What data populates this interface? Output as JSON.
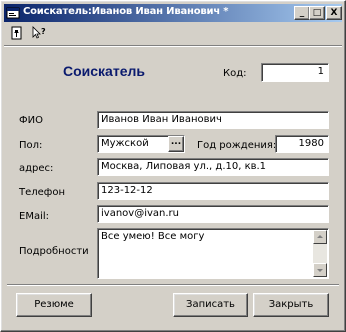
{
  "window": {
    "title": "Соискатель:Иванов Иван Иванович *",
    "controls": {
      "minimize": "_",
      "maximize": "□",
      "close": "X"
    }
  },
  "toolbar": {
    "icons": [
      "document-pin-icon",
      "help-pointer-icon"
    ]
  },
  "form": {
    "heading": "Соискатель",
    "code_label": "Код:",
    "code_value": "1",
    "fio_label": "ФИО",
    "fio_value": "Иванов Иван Иванович",
    "sex_label": "Пол:",
    "sex_value": "Мужской",
    "sex_button": "...",
    "birth_label": "Год рождения:",
    "birth_value": "1980",
    "address_label": "адрес:",
    "address_value": "Москва, Липовая ул., д.10, кв.1",
    "phone_label": "Телефон",
    "phone_value": "123-12-12",
    "email_label": "EMail:",
    "email_value": "ivanov@ivan.ru",
    "details_label": "Подробности",
    "details_value": "Все умею! Все могу"
  },
  "buttons": {
    "resume": "Резюме",
    "save": "Записать",
    "close": "Закрыть"
  }
}
